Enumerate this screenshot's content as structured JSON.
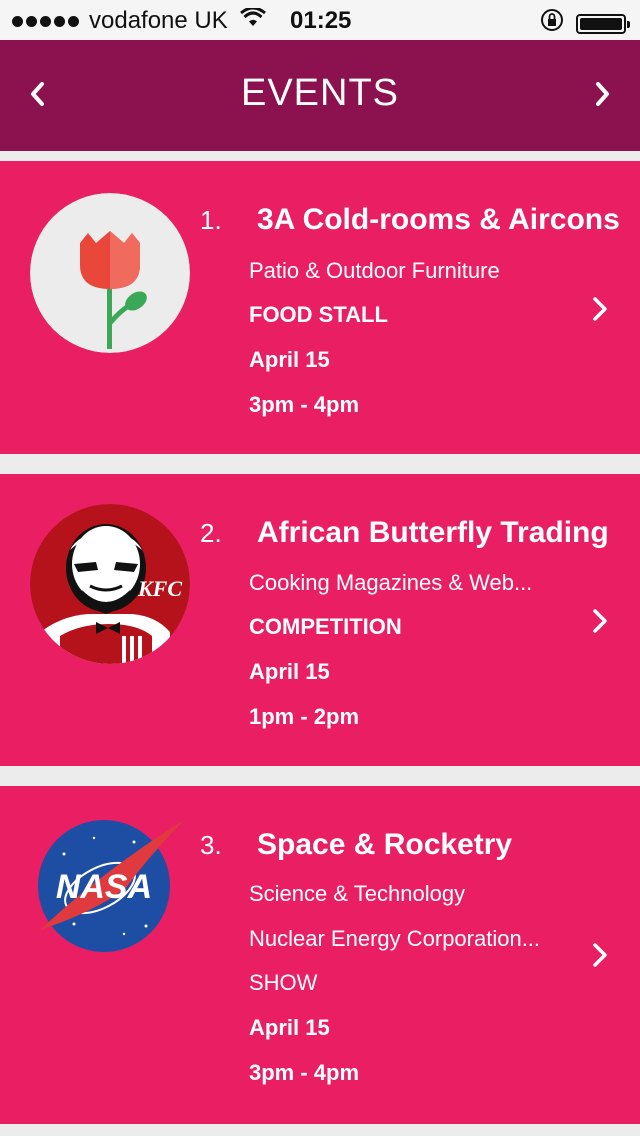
{
  "status_bar": {
    "carrier": "vodafone UK",
    "time": "01:25"
  },
  "header": {
    "title": "EVENTS",
    "prev_icon": "chevron-left-icon",
    "next_icon": "chevron-right-icon"
  },
  "colors": {
    "header_bg": "#8c114f",
    "card_bg": "#e91e63",
    "page_bg": "#ececec"
  },
  "events": [
    {
      "number": "1.",
      "title": "3A Cold-rooms & Aircons",
      "category": "Patio & Outdoor Furniture",
      "type": "FOOD STALL",
      "date": "April 15",
      "time": "3pm - 4pm",
      "logo": "tulip-logo"
    },
    {
      "number": "2.",
      "title": "African Butterfly Trading",
      "category": "Cooking Magazines & Web...",
      "type": "COMPETITION",
      "date": "April 15",
      "time": "1pm - 2pm",
      "logo": "kfc-logo",
      "logo_text": "KFC"
    },
    {
      "number": "3.",
      "title": "Space & Rocketry",
      "category": "Science & Technology",
      "company": "Nuclear Energy Corporation...",
      "type": "SHOW",
      "date": "April 15",
      "time": "3pm - 4pm",
      "logo": "nasa-logo",
      "logo_text": "NASA"
    }
  ]
}
